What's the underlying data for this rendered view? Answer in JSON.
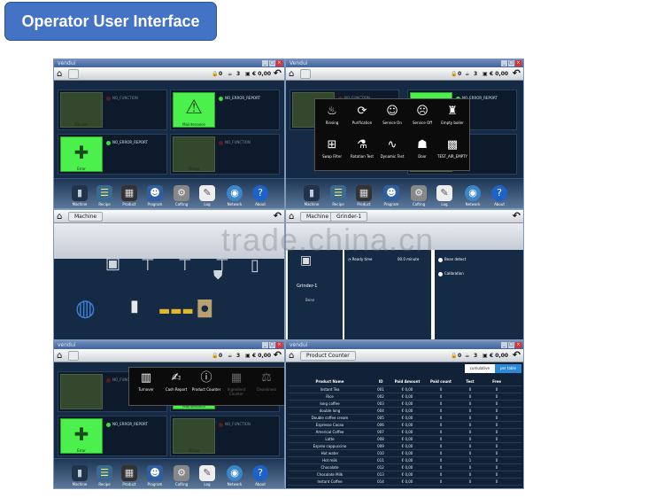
{
  "banner": {
    "title": "Operator User Interface"
  },
  "window": {
    "title": "Vendui",
    "title_small": "vendui"
  },
  "status": {
    "locks": "0",
    "cups": "3",
    "price": "€ 0,00",
    "cups_b": "0",
    "price_b": "€ 0,00"
  },
  "crumbs": {
    "machine": "Machine",
    "grinder": "Grinder-1",
    "product_counter": "Product Counter"
  },
  "tiles": [
    {
      "label": "NO_FUNCTION",
      "cap": "Grinder"
    },
    {
      "label": "NO_ERROR_REPORT",
      "cap": "Maintenance"
    },
    {
      "label": "NO_ERROR_REPORT",
      "cap": "Error"
    },
    {
      "label": "NO_FUNCTION",
      "cap": "Filling"
    }
  ],
  "dock": [
    "Machine",
    "Recipe",
    "Product",
    "Program",
    "Cafting",
    "Log",
    "Network",
    "About"
  ],
  "popup_service": [
    {
      "label": "Rinsing"
    },
    {
      "label": "Purification"
    },
    {
      "label": "Service On"
    },
    {
      "label": "Service Off"
    },
    {
      "label": "Empty boiler"
    },
    {
      "label": "Swap Filter"
    },
    {
      "label": "Rotation Test"
    },
    {
      "label": "Dynamic Test"
    },
    {
      "label": "Door"
    },
    {
      "label": "TEST_AIR_EMPTY"
    }
  ],
  "popup_counter": [
    {
      "label": "Turnover"
    },
    {
      "label": "Cash Report"
    },
    {
      "label": "Product Counter"
    },
    {
      "label": "Ingredient Counter"
    },
    {
      "label": "Cleanliness"
    }
  ],
  "grinder": {
    "name": "Grinder-1",
    "bean": "Bean",
    "ready_label": "Ready time",
    "ready_value": "00.0 minute",
    "opt1": "Bean detect",
    "opt2": "Calibration"
  },
  "counter_tabs": [
    "cumulative",
    "per table"
  ],
  "table": {
    "headers": [
      "Product Name",
      "ID",
      "Paid Amount",
      "Paid count",
      "Test",
      "Free"
    ],
    "rows": [
      [
        "Instant Tea",
        "001",
        "€ 0,00",
        "0",
        "0",
        "0"
      ],
      [
        "Rice",
        "002",
        "€ 0,00",
        "0",
        "0",
        "0"
      ],
      [
        "long coffee",
        "003",
        "€ 0,00",
        "0",
        "0",
        "0"
      ],
      [
        "double long",
        "004",
        "€ 0,00",
        "0",
        "0",
        "0"
      ],
      [
        "Double coffee cream",
        "005",
        "€ 0,00",
        "0",
        "0",
        "0"
      ],
      [
        "Espresso Cacao",
        "006",
        "€ 0,00",
        "0",
        "0",
        "0"
      ],
      [
        "Americal Coffee",
        "007",
        "€ 0,00",
        "0",
        "0",
        "0"
      ],
      [
        "Latte",
        "008",
        "€ 0,00",
        "0",
        "0",
        "0"
      ],
      [
        "Espreo cappuccino",
        "009",
        "€ 0,00",
        "0",
        "0",
        "0"
      ],
      [
        "Hot water",
        "010",
        "€ 0,00",
        "0",
        "0",
        "0"
      ],
      [
        "Hot milk",
        "011",
        "€ 0,00",
        "0",
        "1",
        "0"
      ],
      [
        "Chocolate",
        "012",
        "€ 0,00",
        "0",
        "0",
        "0"
      ],
      [
        "Chocolate Milk",
        "013",
        "€ 0,00",
        "0",
        "0",
        "0"
      ],
      [
        "Instant Coffee",
        "014",
        "€ 0,00",
        "0",
        "0",
        "0"
      ]
    ]
  },
  "watermark": "trade.china.cn"
}
